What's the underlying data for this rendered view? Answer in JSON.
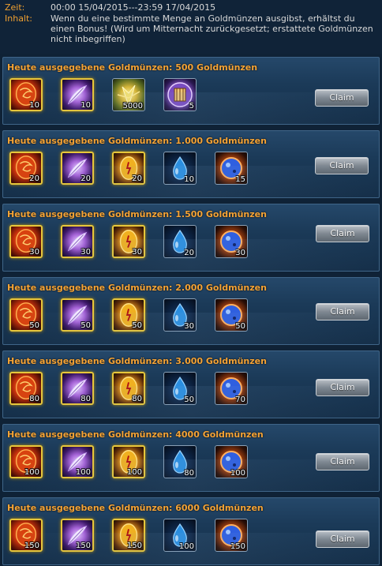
{
  "header": {
    "time_label": "Zeit:",
    "time_value": "00:00 15/04/2015---23:59 17/04/2015",
    "content_label": "Inhalt:",
    "content_value": "Wenn du eine bestimmte Menge an Goldmünzen ausgibst, erhältst du einen Bonus! (Wird um Mitternacht zurückgesetzt; erstattete Goldmünzen nicht inbegriffen)"
  },
  "tiers": [
    {
      "title": "Heute ausgegebene Goldmünzen: 500 Goldmünzen",
      "claim_label": "Claim",
      "items": [
        {
          "icon": "red-gem-icon",
          "count": "10"
        },
        {
          "icon": "feather-icon",
          "count": "10"
        },
        {
          "icon": "golden-wing-icon",
          "count": "5000"
        },
        {
          "icon": "cage-icon",
          "count": "5"
        }
      ]
    },
    {
      "title": "Heute ausgegebene Goldmünzen: 1.000 Goldmünzen",
      "claim_label": "Claim",
      "items": [
        {
          "icon": "red-gem-icon",
          "count": "20"
        },
        {
          "icon": "feather-icon",
          "count": "20"
        },
        {
          "icon": "golden-egg-icon",
          "count": "20"
        },
        {
          "icon": "water-drop-icon",
          "count": "10"
        },
        {
          "icon": "blue-orb-icon",
          "count": "15"
        }
      ]
    },
    {
      "title": "Heute ausgegebene Goldmünzen: 1.500 Goldmünzen",
      "claim_label": "Claim",
      "items": [
        {
          "icon": "red-gem-icon",
          "count": "30"
        },
        {
          "icon": "feather-icon",
          "count": "30"
        },
        {
          "icon": "golden-egg-icon",
          "count": "30"
        },
        {
          "icon": "water-drop-icon",
          "count": "20"
        },
        {
          "icon": "blue-orb-icon",
          "count": "30"
        }
      ]
    },
    {
      "title": "Heute ausgegebene Goldmünzen: 2.000 Goldmünzen",
      "claim_label": "Claim",
      "items": [
        {
          "icon": "red-gem-icon",
          "count": "50"
        },
        {
          "icon": "feather-icon",
          "count": "50"
        },
        {
          "icon": "golden-egg-icon",
          "count": "50"
        },
        {
          "icon": "water-drop-icon",
          "count": "30"
        },
        {
          "icon": "blue-orb-icon",
          "count": "50"
        }
      ]
    },
    {
      "title": "Heute ausgegebene Goldmünzen: 3.000 Goldmünzen",
      "claim_label": "Claim",
      "items": [
        {
          "icon": "red-gem-icon",
          "count": "80"
        },
        {
          "icon": "feather-icon",
          "count": "80"
        },
        {
          "icon": "golden-egg-icon",
          "count": "80"
        },
        {
          "icon": "water-drop-icon",
          "count": "50"
        },
        {
          "icon": "blue-orb-icon",
          "count": "70"
        }
      ]
    },
    {
      "title": "Heute ausgegebene Goldmünzen: 4000 Goldmünzen",
      "claim_label": "Claim",
      "items": [
        {
          "icon": "red-gem-icon",
          "count": "100"
        },
        {
          "icon": "feather-icon",
          "count": "100"
        },
        {
          "icon": "golden-egg-icon",
          "count": "100"
        },
        {
          "icon": "water-drop-icon",
          "count": "80"
        },
        {
          "icon": "blue-orb-icon",
          "count": "100"
        }
      ]
    },
    {
      "title": "Heute ausgegebene Goldmünzen: 6000 Goldmünzen",
      "claim_label": "Claim",
      "items": [
        {
          "icon": "red-gem-icon",
          "count": "150"
        },
        {
          "icon": "feather-icon",
          "count": "150"
        },
        {
          "icon": "golden-egg-icon",
          "count": "150"
        },
        {
          "icon": "water-drop-icon",
          "count": "100"
        },
        {
          "icon": "blue-orb-icon",
          "count": "150"
        }
      ]
    }
  ],
  "colors": {
    "label_orange": "#f0a030",
    "title_orange": "#f5a335",
    "panel_blue": "#1b3a58",
    "gold_frame": "#e7c63a"
  }
}
